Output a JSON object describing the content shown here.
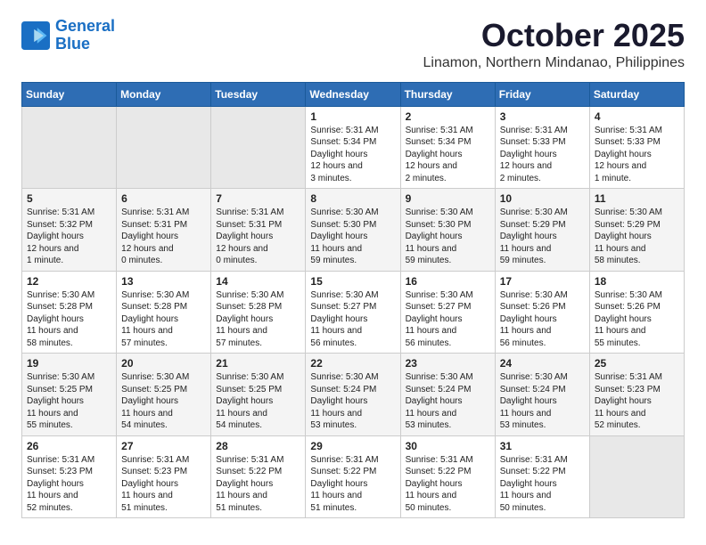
{
  "logo": {
    "line1": "General",
    "line2": "Blue"
  },
  "header": {
    "month": "October 2025",
    "location": "Linamon, Northern Mindanao, Philippines"
  },
  "weekdays": [
    "Sunday",
    "Monday",
    "Tuesday",
    "Wednesday",
    "Thursday",
    "Friday",
    "Saturday"
  ],
  "weeks": [
    [
      {
        "day": "",
        "empty": true
      },
      {
        "day": "",
        "empty": true
      },
      {
        "day": "",
        "empty": true
      },
      {
        "day": "1",
        "sunrise": "5:31 AM",
        "sunset": "5:34 PM",
        "daylight": "12 hours and 3 minutes."
      },
      {
        "day": "2",
        "sunrise": "5:31 AM",
        "sunset": "5:34 PM",
        "daylight": "12 hours and 2 minutes."
      },
      {
        "day": "3",
        "sunrise": "5:31 AM",
        "sunset": "5:33 PM",
        "daylight": "12 hours and 2 minutes."
      },
      {
        "day": "4",
        "sunrise": "5:31 AM",
        "sunset": "5:33 PM",
        "daylight": "12 hours and 1 minute."
      }
    ],
    [
      {
        "day": "5",
        "sunrise": "5:31 AM",
        "sunset": "5:32 PM",
        "daylight": "12 hours and 1 minute."
      },
      {
        "day": "6",
        "sunrise": "5:31 AM",
        "sunset": "5:31 PM",
        "daylight": "12 hours and 0 minutes."
      },
      {
        "day": "7",
        "sunrise": "5:31 AM",
        "sunset": "5:31 PM",
        "daylight": "12 hours and 0 minutes."
      },
      {
        "day": "8",
        "sunrise": "5:30 AM",
        "sunset": "5:30 PM",
        "daylight": "11 hours and 59 minutes."
      },
      {
        "day": "9",
        "sunrise": "5:30 AM",
        "sunset": "5:30 PM",
        "daylight": "11 hours and 59 minutes."
      },
      {
        "day": "10",
        "sunrise": "5:30 AM",
        "sunset": "5:29 PM",
        "daylight": "11 hours and 59 minutes."
      },
      {
        "day": "11",
        "sunrise": "5:30 AM",
        "sunset": "5:29 PM",
        "daylight": "11 hours and 58 minutes."
      }
    ],
    [
      {
        "day": "12",
        "sunrise": "5:30 AM",
        "sunset": "5:28 PM",
        "daylight": "11 hours and 58 minutes."
      },
      {
        "day": "13",
        "sunrise": "5:30 AM",
        "sunset": "5:28 PM",
        "daylight": "11 hours and 57 minutes."
      },
      {
        "day": "14",
        "sunrise": "5:30 AM",
        "sunset": "5:28 PM",
        "daylight": "11 hours and 57 minutes."
      },
      {
        "day": "15",
        "sunrise": "5:30 AM",
        "sunset": "5:27 PM",
        "daylight": "11 hours and 56 minutes."
      },
      {
        "day": "16",
        "sunrise": "5:30 AM",
        "sunset": "5:27 PM",
        "daylight": "11 hours and 56 minutes."
      },
      {
        "day": "17",
        "sunrise": "5:30 AM",
        "sunset": "5:26 PM",
        "daylight": "11 hours and 56 minutes."
      },
      {
        "day": "18",
        "sunrise": "5:30 AM",
        "sunset": "5:26 PM",
        "daylight": "11 hours and 55 minutes."
      }
    ],
    [
      {
        "day": "19",
        "sunrise": "5:30 AM",
        "sunset": "5:25 PM",
        "daylight": "11 hours and 55 minutes."
      },
      {
        "day": "20",
        "sunrise": "5:30 AM",
        "sunset": "5:25 PM",
        "daylight": "11 hours and 54 minutes."
      },
      {
        "day": "21",
        "sunrise": "5:30 AM",
        "sunset": "5:25 PM",
        "daylight": "11 hours and 54 minutes."
      },
      {
        "day": "22",
        "sunrise": "5:30 AM",
        "sunset": "5:24 PM",
        "daylight": "11 hours and 53 minutes."
      },
      {
        "day": "23",
        "sunrise": "5:30 AM",
        "sunset": "5:24 PM",
        "daylight": "11 hours and 53 minutes."
      },
      {
        "day": "24",
        "sunrise": "5:30 AM",
        "sunset": "5:24 PM",
        "daylight": "11 hours and 53 minutes."
      },
      {
        "day": "25",
        "sunrise": "5:31 AM",
        "sunset": "5:23 PM",
        "daylight": "11 hours and 52 minutes."
      }
    ],
    [
      {
        "day": "26",
        "sunrise": "5:31 AM",
        "sunset": "5:23 PM",
        "daylight": "11 hours and 52 minutes."
      },
      {
        "day": "27",
        "sunrise": "5:31 AM",
        "sunset": "5:23 PM",
        "daylight": "11 hours and 51 minutes."
      },
      {
        "day": "28",
        "sunrise": "5:31 AM",
        "sunset": "5:22 PM",
        "daylight": "11 hours and 51 minutes."
      },
      {
        "day": "29",
        "sunrise": "5:31 AM",
        "sunset": "5:22 PM",
        "daylight": "11 hours and 51 minutes."
      },
      {
        "day": "30",
        "sunrise": "5:31 AM",
        "sunset": "5:22 PM",
        "daylight": "11 hours and 50 minutes."
      },
      {
        "day": "31",
        "sunrise": "5:31 AM",
        "sunset": "5:22 PM",
        "daylight": "11 hours and 50 minutes."
      },
      {
        "day": "",
        "empty": true
      }
    ]
  ],
  "labels": {
    "sunrise": "Sunrise:",
    "sunset": "Sunset:",
    "daylight": "Daylight hours"
  }
}
